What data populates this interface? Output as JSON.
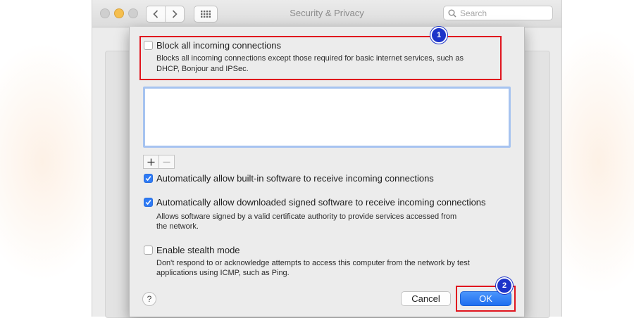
{
  "window": {
    "title": "Security & Privacy",
    "search_placeholder": "Search"
  },
  "sheet": {
    "block_all": {
      "label": "Block all incoming connections",
      "checked": false,
      "description_line1": "Blocks all incoming connections except those required for basic internet services, such as",
      "description_line2": "DHCP, Bonjour and IPSec."
    },
    "app_list": [],
    "add_symbol": "+",
    "remove_symbol": "−",
    "auto_builtin": {
      "label": "Automatically allow built-in software to receive incoming connections",
      "checked": true
    },
    "auto_signed": {
      "label": "Automatically allow downloaded signed software to receive incoming connections",
      "checked": true,
      "description_line1": "Allows software signed by a valid certificate authority to provide services accessed from",
      "description_line2": "the network."
    },
    "stealth": {
      "label": "Enable stealth mode",
      "checked": false,
      "description_line1": "Don't respond to or acknowledge attempts to access this computer from the network by test",
      "description_line2": "applications using ICMP, such as Ping."
    },
    "help_label": "?",
    "cancel_label": "Cancel",
    "ok_label": "OK"
  },
  "annotations": {
    "marker1": "1",
    "marker2": "2",
    "highlight_color": "#e0151e",
    "marker_color": "#1d34c9"
  },
  "colors": {
    "accent": "#2f7bf5",
    "ok_button": "#1f6ff0"
  }
}
